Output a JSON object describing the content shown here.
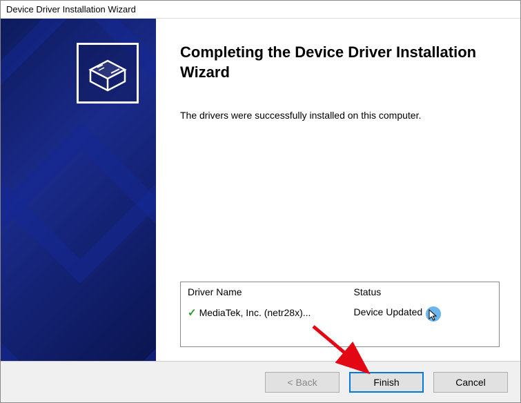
{
  "window": {
    "title": "Device Driver Installation Wizard"
  },
  "main": {
    "heading": "Completing the Device Driver Installation Wizard",
    "description": "The drivers were successfully installed on this computer."
  },
  "driver_list": {
    "header_name": "Driver Name",
    "header_status": "Status",
    "rows": [
      {
        "name": "MediaTek, Inc. (netr28x)...",
        "status": "Device Updated"
      }
    ]
  },
  "buttons": {
    "back": "< Back",
    "finish": "Finish",
    "cancel": "Cancel"
  }
}
